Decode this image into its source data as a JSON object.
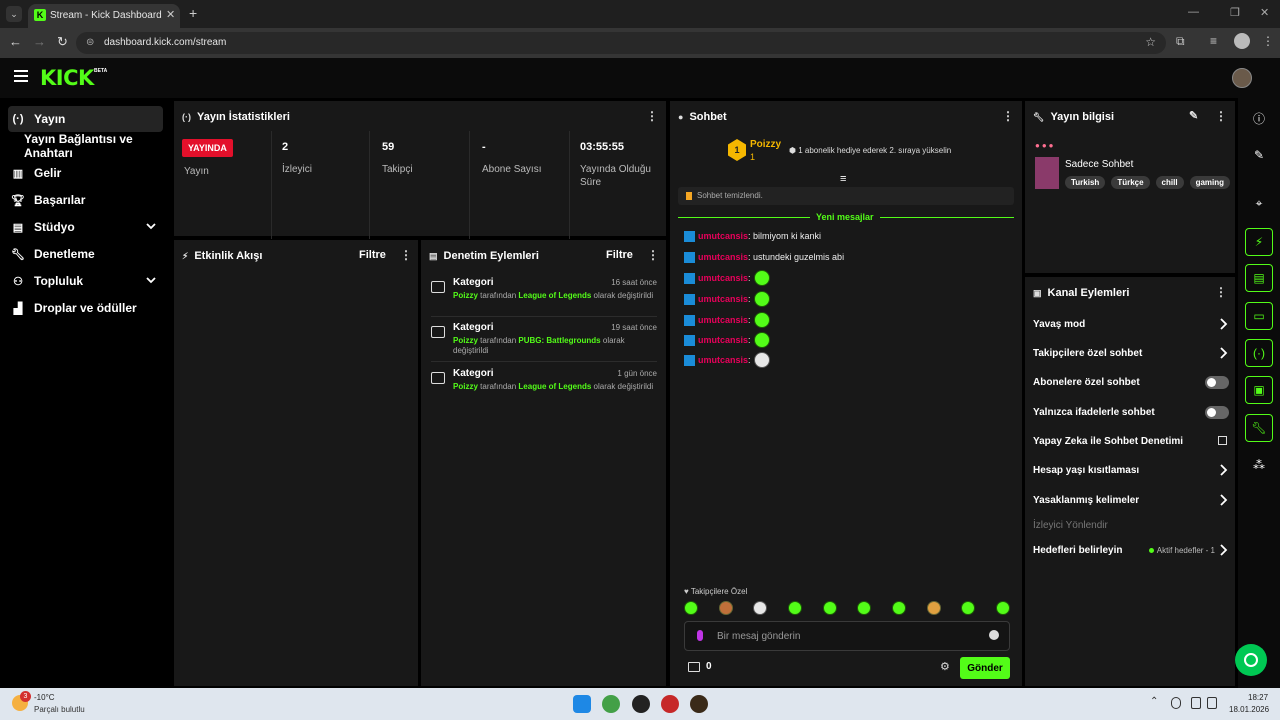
{
  "browser": {
    "tab_title": "Stream - Kick Dashboard",
    "tab_favicon_letter": "K",
    "url": "dashboard.kick.com/stream"
  },
  "header": {
    "logo": "KICK",
    "logo_badge": "BETA"
  },
  "sidebar": {
    "items": [
      {
        "label": "Yayın",
        "icon": "broadcast-icon"
      },
      {
        "label": "Yayın Bağlantısı ve Anahtarı"
      },
      {
        "label": "Gelir",
        "icon": "revenue-icon"
      },
      {
        "label": "Başarılar",
        "icon": "trophy-icon"
      },
      {
        "label": "Stüdyo",
        "icon": "studio-icon"
      },
      {
        "label": "Denetleme",
        "icon": "wrench-icon"
      },
      {
        "label": "Topluluk",
        "icon": "community-icon"
      },
      {
        "label": "Droplar ve ödüller",
        "icon": "drops-icon"
      }
    ]
  },
  "stats": {
    "title": "Yayın İstatistikleri",
    "live_badge": "YAYINDA",
    "items": [
      {
        "value": "",
        "label": "Yayın"
      },
      {
        "value": "2",
        "label": "İzleyici"
      },
      {
        "value": "59",
        "label": "Takipçi"
      },
      {
        "value": "-",
        "label": "Abone Sayısı"
      },
      {
        "value": "03:55:55",
        "label": "Yayında Olduğu Süre"
      }
    ]
  },
  "activity": {
    "title": "Etkinlik Akışı",
    "filter_label": "Filtre"
  },
  "moderation": {
    "title": "Denetim Eylemleri",
    "filter_label": "Filtre",
    "connector": "tarafından",
    "suffix": "olarak değiştirildi",
    "items": [
      {
        "title": "Kategori",
        "time": "16 saat önce",
        "user": "Poizzy",
        "category": "League of Legends"
      },
      {
        "title": "Kategori",
        "time": "19 saat önce",
        "user": "Poizzy",
        "category": "PUBG: Battlegrounds"
      },
      {
        "title": "Kategori",
        "time": "1 gün önce",
        "user": "Poizzy",
        "category": "League of Legends"
      }
    ]
  },
  "chat": {
    "title": "Sohbet",
    "pinned": {
      "rank": "1",
      "name": "Poizzy",
      "count": "1",
      "message": "1 abonelik hediye ederek 2. sıraya yükselin"
    },
    "cleared_notice": "Sohbet temizlendi.",
    "new_messages_label": "Yeni mesajlar",
    "messages": [
      {
        "user": "umutcansis",
        "text": ": bilmiyom ki kanki"
      },
      {
        "user": "umutcansis",
        "text": ": ustundeki guzelmis abi"
      },
      {
        "user": "umutcansis",
        "text": ":"
      },
      {
        "user": "umutcansis",
        "text": ":"
      },
      {
        "user": "umutcansis",
        "text": ":"
      },
      {
        "user": "umutcansis",
        "text": ":"
      },
      {
        "user": "umutcansis",
        "text": ":"
      }
    ],
    "followers_only_label": "Takipçilere Özel",
    "input_placeholder": "Bir mesaj gönderin",
    "points": "0",
    "send_label": "Gönder"
  },
  "stream_info": {
    "title": "Yayın bilgisi",
    "stream_title": "Sadece Sohbet",
    "tags": [
      "Turkish",
      "Türkçe",
      "chill",
      "gaming"
    ]
  },
  "channel_actions": {
    "title": "Kanal Eylemleri",
    "items": [
      {
        "label": "Yavaş mod"
      },
      {
        "label": "Takipçilere özel sohbet"
      },
      {
        "label": "Abonelere özel sohbet"
      },
      {
        "label": "Yalnızca ifadelerle sohbet"
      },
      {
        "label": "Yapay Zeka ile Sohbet Denetimi"
      },
      {
        "label": "Hesap yaşı kısıtlaması"
      },
      {
        "label": "Yasaklanmış kelimeler"
      },
      {
        "label": "İzleyici Yönlendir"
      },
      {
        "label": "Hedefleri belirleyin"
      }
    ],
    "active_goals": "Aktif hedefler - 1"
  },
  "taskbar": {
    "weather_badge": "3",
    "temperature": "-10°C",
    "weather_desc": "Parçalı bulutlu",
    "time": "18:27",
    "date": "18.01.2026"
  },
  "colors": {
    "brand": "#53fc18",
    "live": "#e3102b",
    "chat_user": "#e8005a",
    "gift_gold": "#f5b700"
  }
}
